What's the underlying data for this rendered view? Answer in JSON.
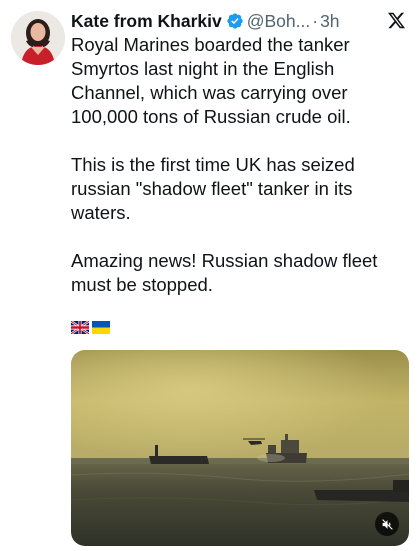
{
  "tweet": {
    "author_name": "Kate from Kharkiv",
    "handle": "@Boh...",
    "separator": "·",
    "time": "3h",
    "verified": true,
    "paragraphs": [
      "Royal Marines boarded the tanker Smyrtos last night in the English Channel, which was carrying over 100,000 tons of Russian crude oil.",
      "This is the first time UK has seized russian \"shadow fleet\" tanker in its waters.",
      "Amazing news! Russian shadow fleet must be stopped."
    ],
    "flags": [
      "united-kingdom-flag",
      "ukraine-flag"
    ]
  },
  "icons": {
    "close": "x-logo-icon",
    "verified": "verified-badge-icon",
    "mute": "speaker-muted-icon"
  },
  "colors": {
    "text": "#0f1419",
    "secondary_text": "#536471",
    "verified_blue": "#1d9bf0",
    "media_sky": "#b5a55a",
    "media_sea": "#3a3a2c"
  }
}
